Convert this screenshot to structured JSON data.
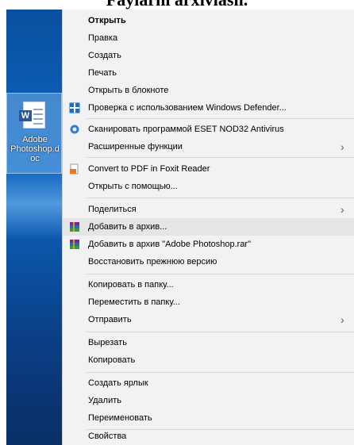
{
  "caption": "Faylarni arxivlash.",
  "desktop": {
    "file_label": "Adobe Photoshop.doc",
    "file_label_lines": [
      "Adobe",
      "Photoshop.d",
      "oc"
    ],
    "file_icon_letter": "W"
  },
  "menu": {
    "items": [
      {
        "label": "Открыть",
        "bold": true
      },
      {
        "label": "Правка"
      },
      {
        "label": "Создать"
      },
      {
        "label": "Печать"
      },
      {
        "label": "Открыть в блокноте"
      },
      {
        "label": "Проверка с использованием Windows Defender...",
        "icon": "windows-defender-icon"
      },
      {
        "label": "Сканировать программой ESET NOD32 Antivirus",
        "icon": "eset-nod32-icon"
      },
      {
        "label": "Расширенные функции",
        "submenu": true
      },
      {
        "label": "Convert to PDF in Foxit Reader",
        "icon": "foxit-pdf-icon"
      },
      {
        "label": "Открыть с помощью..."
      },
      {
        "label": "Поделиться",
        "submenu": true
      },
      {
        "label": "Добавить в архив...",
        "icon": "winrar-icon",
        "highlighted": true
      },
      {
        "label": "Добавить в архив \"Adobe Photoshop.rar\"",
        "icon": "winrar-icon"
      },
      {
        "label": "Восстановить прежнюю версию"
      },
      {
        "label": "Копировать в папку..."
      },
      {
        "label": "Переместить в папку..."
      },
      {
        "label": "Отправить",
        "submenu": true
      },
      {
        "label": "Вырезать"
      },
      {
        "label": "Копировать"
      },
      {
        "label": "Создать ярлык"
      },
      {
        "label": "Удалить"
      },
      {
        "label": "Переименовать"
      },
      {
        "label": "Свойства"
      }
    ],
    "submenu_arrow": "›",
    "colors": {
      "background": "#f2f2f2",
      "hover": "#e5e5e5",
      "separator": "#d7d7d7",
      "desktop": "#0c66c2"
    }
  }
}
